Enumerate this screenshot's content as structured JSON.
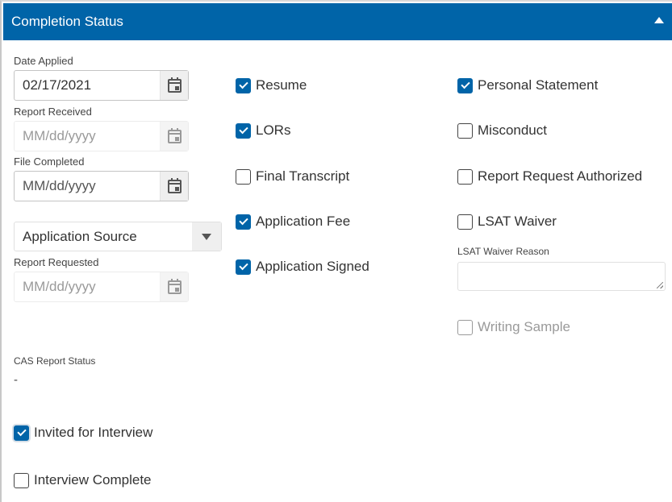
{
  "header": {
    "title": "Completion Status",
    "collapse_icon": "triangle-up-icon"
  },
  "fields": {
    "date_applied": {
      "label": "Date Applied",
      "value": "02/17/2021",
      "placeholder": "MM/dd/yyyy",
      "disabled": false
    },
    "report_received": {
      "label": "Report Received",
      "value": "",
      "placeholder": "MM/dd/yyyy",
      "disabled": true
    },
    "file_completed": {
      "label": "File Completed",
      "value": "",
      "placeholder": "MM/dd/yyyy",
      "disabled": false
    },
    "application_source": {
      "selected": "Application Source"
    },
    "report_requested": {
      "label": "Report Requested",
      "value": "",
      "placeholder": "MM/dd/yyyy",
      "disabled": true
    },
    "lsat_waiver_reason": {
      "label": "LSAT Waiver Reason",
      "value": ""
    },
    "cas_report_status": {
      "label": "CAS Report Status",
      "value": "-"
    }
  },
  "checkboxes": {
    "resume": {
      "label": "Resume",
      "checked": true
    },
    "lors": {
      "label": "LORs",
      "checked": true
    },
    "final_transcript": {
      "label": "Final Transcript",
      "checked": false
    },
    "application_fee": {
      "label": "Application Fee",
      "checked": true
    },
    "application_signed": {
      "label": "Application Signed",
      "checked": true
    },
    "personal_statement": {
      "label": "Personal Statement",
      "checked": true
    },
    "misconduct": {
      "label": "Misconduct",
      "checked": false
    },
    "report_request_authorized": {
      "label": "Report Request Authorized",
      "checked": false
    },
    "lsat_waiver": {
      "label": "LSAT Waiver",
      "checked": false
    },
    "writing_sample": {
      "label": "Writing Sample",
      "checked": false,
      "disabled": true
    },
    "invited_for_interview": {
      "label": "Invited for Interview",
      "checked": true
    },
    "interview_complete": {
      "label": "Interview Complete",
      "checked": false
    }
  },
  "colors": {
    "header_bg": "#0064a8",
    "checkbox_checked": "#0064a8"
  }
}
